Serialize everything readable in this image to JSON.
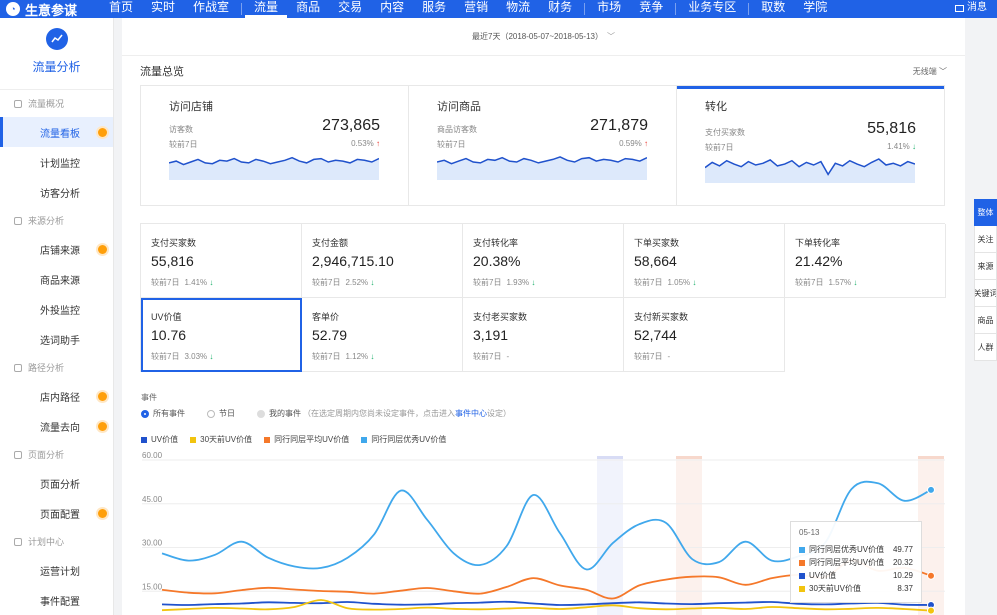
{
  "nav": {
    "brand": "生意参谋",
    "items": [
      {
        "label": "首页"
      },
      {
        "label": "实时"
      },
      {
        "label": "作战室"
      },
      {
        "label": "流量",
        "active": true
      },
      {
        "label": "商品"
      },
      {
        "label": "交易"
      },
      {
        "label": "内容",
        "dot": true
      },
      {
        "label": "服务"
      },
      {
        "label": "营销"
      },
      {
        "label": "物流"
      },
      {
        "label": "财务"
      },
      {
        "label": "市场"
      },
      {
        "label": "竞争"
      },
      {
        "label": "业务专区"
      },
      {
        "label": "取数"
      },
      {
        "label": "学院"
      }
    ],
    "message": "消息"
  },
  "sidebar": {
    "title": "流量分析",
    "sections": [
      {
        "group": "流量概况",
        "items": [
          {
            "label": "流量看板",
            "active": true,
            "hot": true
          },
          {
            "label": "计划监控"
          },
          {
            "label": "访客分析"
          }
        ]
      },
      {
        "group": "来源分析",
        "items": [
          {
            "label": "店铺来源",
            "hot": true
          },
          {
            "label": "商品来源"
          },
          {
            "label": "外投监控"
          },
          {
            "label": "选词助手"
          }
        ]
      },
      {
        "group": "路径分析",
        "items": [
          {
            "label": "店内路径",
            "hot": true
          },
          {
            "label": "流量去向",
            "hot": true
          }
        ]
      },
      {
        "group": "页面分析",
        "items": [
          {
            "label": "页面分析"
          },
          {
            "label": "页面配置",
            "hot": true
          }
        ]
      },
      {
        "group": "计划中心",
        "items": [
          {
            "label": "运营计划"
          },
          {
            "label": "事件配置"
          }
        ]
      }
    ]
  },
  "date_range": "最近7天（2018-05-07~2018-05-13）",
  "overview": {
    "title": "流量总览",
    "option": "无线端",
    "cards": [
      {
        "name": "访问店铺",
        "sub": "访客数",
        "cmp": "较前7日",
        "value": "273,865",
        "pct": "0.53%",
        "dir": "up",
        "spark": [
          20,
          22,
          18,
          21,
          24,
          20,
          19,
          23,
          22,
          25,
          21,
          20,
          24,
          22,
          19,
          21,
          23,
          26,
          22,
          20,
          24,
          25,
          21,
          23,
          22,
          20,
          24,
          23,
          21,
          25
        ]
      },
      {
        "name": "访问商品",
        "sub": "商品访客数",
        "cmp": "较前7日",
        "value": "271,879",
        "pct": "0.59%",
        "dir": "up",
        "spark": [
          21,
          23,
          19,
          22,
          25,
          21,
          20,
          24,
          23,
          26,
          22,
          21,
          25,
          23,
          20,
          22,
          24,
          27,
          23,
          21,
          25,
          26,
          22,
          24,
          23,
          21,
          25,
          24,
          22,
          26
        ]
      },
      {
        "name": "转化",
        "sub": "支付买家数",
        "cmp": "较前7日",
        "value": "55,816",
        "pct": "1.41%",
        "dir": "down",
        "selected": true,
        "spark": [
          18,
          24,
          20,
          26,
          22,
          19,
          25,
          21,
          23,
          27,
          20,
          22,
          26,
          19,
          24,
          21,
          25,
          10,
          23,
          20,
          26,
          22,
          19,
          24,
          28,
          21,
          23,
          20,
          25,
          22
        ]
      }
    ]
  },
  "metrics": [
    {
      "name": "支付买家数",
      "value": "55,816",
      "cmp": "较前7日",
      "pct": "1.41%",
      "dir": "down"
    },
    {
      "name": "支付金额",
      "value": "2,946,715.10",
      "cmp": "较前7日",
      "pct": "2.52%",
      "dir": "down"
    },
    {
      "name": "支付转化率",
      "value": "20.38%",
      "cmp": "较前7日",
      "pct": "1.93%",
      "dir": "down"
    },
    {
      "name": "下单买家数",
      "value": "58,664",
      "cmp": "较前7日",
      "pct": "1.05%",
      "dir": "down"
    },
    {
      "name": "下单转化率",
      "value": "21.42%",
      "cmp": "较前7日",
      "pct": "1.57%",
      "dir": "down"
    },
    {
      "name": "UV价值",
      "value": "10.76",
      "cmp": "较前7日",
      "pct": "3.03%",
      "dir": "down",
      "selected": true
    },
    {
      "name": "客单价",
      "value": "52.79",
      "cmp": "较前7日",
      "pct": "1.12%",
      "dir": "down"
    },
    {
      "name": "支付老买家数",
      "value": "3,191",
      "cmp": "较前7日",
      "pct": "-",
      "dir": "none"
    },
    {
      "name": "支付新买家数",
      "value": "52,744",
      "cmp": "较前7日",
      "pct": "-",
      "dir": "none"
    }
  ],
  "events": {
    "label": "事件",
    "options": [
      {
        "label": "所有事件",
        "state": "on"
      },
      {
        "label": "节日",
        "state": "normal"
      },
      {
        "label": "我的事件",
        "state": "off"
      }
    ],
    "note_before": "（在选定周期内您尚未设定事件，点击进入",
    "note_link": "事件中心",
    "note_after": "设定）"
  },
  "colors": {
    "uv": "#2052cc",
    "uv30": "#f2c40f",
    "avg": "#f5782a",
    "excellent": "#40a8ec",
    "accent": "#2062e6"
  },
  "chart_data": {
    "type": "line",
    "ylim": [
      0,
      60
    ],
    "yticks": [
      "60.00",
      "45.00",
      "30.00",
      "15.00"
    ],
    "series": [
      {
        "name": "UV价值",
        "color": "#2052cc",
        "values": [
          10.5,
          10.3,
          10.6,
          10.8,
          11.2,
          11.0,
          10.9,
          11.3,
          10.7,
          10.4,
          10.5,
          10.9,
          11.1,
          11.4,
          10.8,
          10.3,
          10.5,
          10.9,
          11.2,
          10.8,
          10.6,
          10.9,
          11.1,
          11.3,
          10.7,
          10.5,
          10.8,
          11.0,
          10.4,
          10.29
        ]
      },
      {
        "name": "30天前UV价值",
        "color": "#f2c40f",
        "values": [
          8.5,
          8.9,
          9.3,
          9.1,
          8.8,
          9.6,
          12.0,
          9.2,
          8.7,
          8.9,
          9.4,
          9.0,
          8.8,
          9.1,
          9.3,
          8.9,
          9.5,
          10.2,
          9.2,
          8.8,
          9.1,
          9.3,
          8.9,
          9.6,
          9.2,
          8.8,
          9.0,
          9.3,
          8.9,
          8.37
        ]
      },
      {
        "name": "同行同层平均UV价值",
        "color": "#f5782a",
        "values": [
          15.5,
          14.5,
          14.3,
          15.4,
          16.2,
          15.6,
          15.1,
          14.8,
          14.2,
          15.2,
          16.1,
          15.0,
          14.2,
          16.5,
          19.5,
          17.0,
          15.5,
          12.5,
          17.0,
          19.0,
          20.0,
          19.8,
          17.2,
          19.5,
          20.6,
          19.8,
          25.5,
          22.0,
          23.0,
          20.32
        ]
      },
      {
        "name": "同行同层优秀UV价值",
        "color": "#40a8ec",
        "values": [
          28.0,
          25.5,
          27.5,
          32.0,
          26.5,
          23.5,
          23.0,
          26.5,
          34.5,
          49.5,
          39.5,
          28.0,
          24.0,
          30.5,
          48.0,
          35.0,
          22.5,
          31.5,
          38.0,
          38.5,
          26.0,
          25.0,
          32.0,
          25.5,
          27.0,
          31.5,
          50.0,
          52.0,
          46.0,
          49.77
        ]
      }
    ]
  },
  "tooltip": {
    "date": "05-13",
    "rows": [
      {
        "name": "同行同层优秀UV价值",
        "value": "49.77",
        "color": "#40a8ec"
      },
      {
        "name": "同行同层平均UV价值",
        "value": "20.32",
        "color": "#f5782a"
      },
      {
        "name": "UV价值",
        "value": "10.29",
        "color": "#2052cc"
      },
      {
        "name": "30天前UV价值",
        "value": "8.37",
        "color": "#f2c40f"
      }
    ]
  },
  "right_tabs": [
    {
      "label": "整体",
      "active": true
    },
    {
      "label": "关注"
    },
    {
      "label": "来源"
    },
    {
      "label": "关键词"
    },
    {
      "label": "商品"
    },
    {
      "label": "人群"
    }
  ]
}
